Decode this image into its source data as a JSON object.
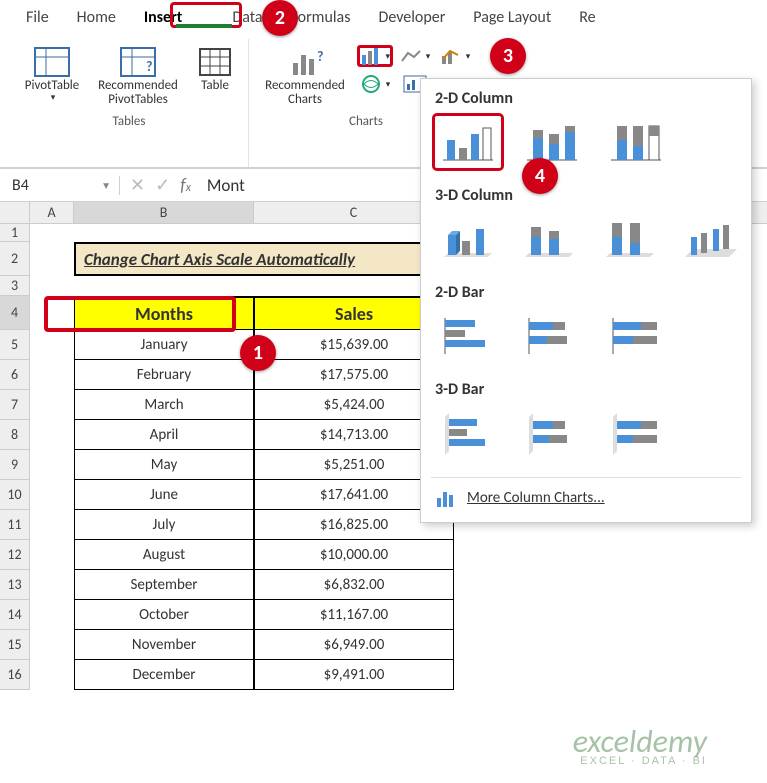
{
  "ribbon": {
    "tabs": [
      "File",
      "Home",
      "Insert",
      "Data",
      "Formulas",
      "Developer",
      "Page Layout",
      "Re"
    ],
    "active_tab": "Insert",
    "groups": {
      "tables": {
        "label": "Tables",
        "pivot": "PivotTable",
        "recommended_pivots_line1": "Recommended",
        "recommended_pivots_line2": "PivotTables",
        "table": "Table"
      },
      "charts": {
        "label": "Charts",
        "recommended_charts_line1": "Recommended",
        "recommended_charts_line2": "Charts"
      }
    }
  },
  "chart_menu": {
    "sec1": "2-D Column",
    "sec2": "3-D Column",
    "sec3": "2-D Bar",
    "sec4": "3-D Bar",
    "more_label": "More Column Charts..."
  },
  "namebox": {
    "ref": "B4"
  },
  "formula": {
    "value": "Mont"
  },
  "columns": {
    "A": "A",
    "B": "B",
    "C": "C"
  },
  "title": "Change Chart Axis Scale Automatically",
  "headers": {
    "months": "Months",
    "sales": "Sales"
  },
  "rows": [
    {
      "n": 5,
      "month": "January",
      "sales": "$15,639.00"
    },
    {
      "n": 6,
      "month": "February",
      "sales": "$17,575.00"
    },
    {
      "n": 7,
      "month": "March",
      "sales": "$5,424.00"
    },
    {
      "n": 8,
      "month": "April",
      "sales": "$14,713.00"
    },
    {
      "n": 9,
      "month": "May",
      "sales": "$5,251.00"
    },
    {
      "n": 10,
      "month": "June",
      "sales": "$17,641.00"
    },
    {
      "n": 11,
      "month": "July",
      "sales": "$16,825.00"
    },
    {
      "n": 12,
      "month": "August",
      "sales": "$10,000.00"
    },
    {
      "n": 13,
      "month": "September",
      "sales": "$6,832.00"
    },
    {
      "n": 14,
      "month": "October",
      "sales": "$11,167.00"
    },
    {
      "n": 15,
      "month": "November",
      "sales": "$6,949.00"
    },
    {
      "n": 16,
      "month": "December",
      "sales": "$9,491.00"
    }
  ],
  "badges": {
    "b1": "1",
    "b2": "2",
    "b3": "3",
    "b4": "4"
  },
  "watermark": {
    "brand": "exceldemy",
    "tagline": "EXCEL · DATA · BI"
  }
}
